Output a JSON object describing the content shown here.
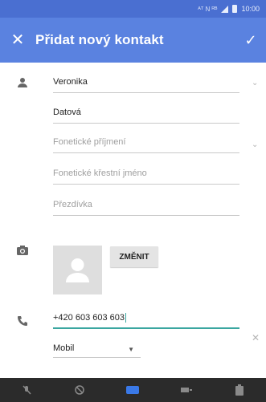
{
  "status_bar": {
    "signal_text": "ᴬᵀ N ᴿᴮ",
    "time": "10:00"
  },
  "header": {
    "title": "Přidat nový kontakt",
    "close_icon": "close-icon",
    "save_icon": "check-icon"
  },
  "form": {
    "first_name": "Veronika",
    "last_name": "Datová",
    "phonetic_last_name_placeholder": "Fonetické příjmení",
    "phonetic_first_name_placeholder": "Fonetické křestní jméno",
    "nickname_placeholder": "Přezdívka",
    "change_photo_label": "ZMĚNIT",
    "phone": "+420 603 603 603",
    "phone_type": "Mobil"
  },
  "colors": {
    "status_bar": "#4a6fd1",
    "app_bar": "#5a82e0",
    "accent": "#3aa6a0"
  }
}
